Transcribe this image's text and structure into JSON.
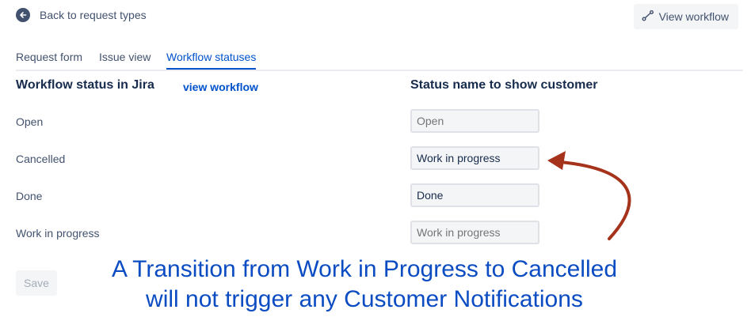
{
  "header": {
    "back_label": "Back to request types",
    "back_icon": "arrow-left-icon",
    "view_workflow_label": "View workflow",
    "view_workflow_icon": "workflow-icon"
  },
  "tabs": [
    {
      "label": "Request form",
      "active": false
    },
    {
      "label": "Issue view",
      "active": false
    },
    {
      "label": "Workflow statuses",
      "active": true
    }
  ],
  "table": {
    "left_header": "Workflow status in Jira",
    "view_link": "view workflow",
    "right_header": "Status name to show customer",
    "rows": [
      {
        "jira_status": "Open",
        "customer_status": "",
        "customer_placeholder": "Open"
      },
      {
        "jira_status": "Cancelled",
        "customer_status": "Work in progress",
        "customer_placeholder": ""
      },
      {
        "jira_status": "Done",
        "customer_status": "Done",
        "customer_placeholder": ""
      },
      {
        "jira_status": "Work in progress",
        "customer_status": "",
        "customer_placeholder": "Work in progress"
      }
    ]
  },
  "save_label": "Save",
  "annotation": {
    "line1": "A Transition from Work in Progress to Cancelled",
    "line2": "will not trigger any Customer Notifications",
    "color": "#0b4cc2",
    "arrow_color": "#a5321a"
  },
  "colors": {
    "link": "#0052cc",
    "text": "#172b4d",
    "subtle": "#42526e"
  }
}
